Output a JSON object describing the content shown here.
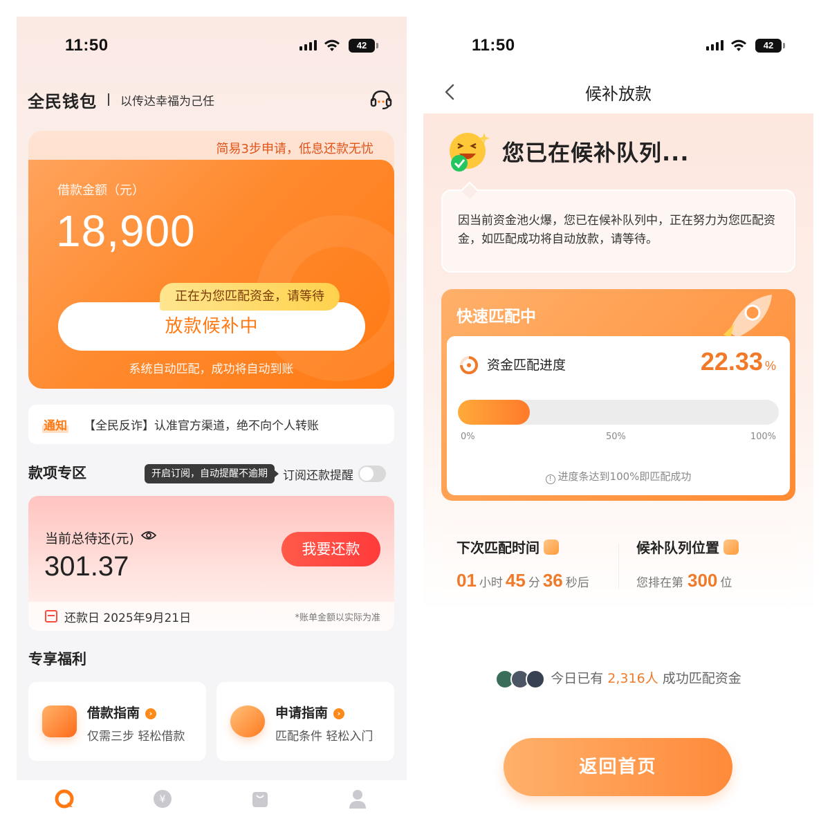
{
  "left": {
    "status": {
      "time": "11:50",
      "battery": "42"
    },
    "header": {
      "brand": "全民钱包",
      "slogan": "以传达幸福为己任"
    },
    "loan_card": {
      "tagline": "简易3步申请，低息还款无忧",
      "amount_label": "借款金额（元）",
      "amount": "18,900",
      "bubble": "正在为您匹配资金，请等待",
      "status_button": "放款候补中",
      "footer": "系统自动匹配，成功将自动到账"
    },
    "notice": {
      "badge": "通知",
      "text": "【全民反诈】认准官方渠道，绝不向个人转账"
    },
    "repay_section": {
      "title": "款项专区",
      "tooltip": "开启订阅，自动提醒不逾期",
      "subscribe_label": "订阅还款提醒",
      "subscribe_on": false
    },
    "repay_card": {
      "label": "当前总待还(元)",
      "amount": "301.37",
      "button": "我要还款",
      "date": "还款日 2025年9月21日",
      "note": "*账单金额以实际为准"
    },
    "benefits": {
      "title": "专享福利",
      "items": [
        {
          "title": "借款指南",
          "subtitle": "仅需三步 轻松借款"
        },
        {
          "title": "申请指南",
          "subtitle": "匹配条件 轻松入门"
        }
      ]
    },
    "tabbar": {
      "icons": [
        "home-icon",
        "yuan-icon",
        "bag-icon",
        "user-icon"
      ],
      "active_color": "#ff7a14"
    }
  },
  "right": {
    "status": {
      "time": "11:50",
      "battery": "42"
    },
    "nav": {
      "title": "候补放款"
    },
    "queue_title": "您已在候补队列...",
    "info_text": "因当前资金池火爆，您已在候补队列中，正在努力为您匹配资金，如匹配成功将自动放款，请等待。",
    "match_panel": {
      "heading": "快速匹配中",
      "progress_label": "资金匹配进度",
      "progress_value": "22.33",
      "progress_unit": "%",
      "progress_fraction": 0.2233,
      "ticks": [
        "0%",
        "50%",
        "100%"
      ],
      "hint": "进度条达到100%即匹配成功"
    },
    "stats": {
      "next_match_title": "下次匹配时间",
      "hours": "01",
      "hours_unit": "小时",
      "minutes": "45",
      "minutes_unit": "分",
      "seconds": "36",
      "seconds_unit": "秒后",
      "queue_title": "候补队列位置",
      "queue_prefix": "您排在第",
      "queue_position": "300",
      "queue_suffix": "位"
    },
    "social": {
      "prefix": "今日已有",
      "count": "2,316人",
      "suffix": "成功匹配资金"
    },
    "home_button": "返回首页"
  },
  "colors": {
    "accent": "#ff7a14",
    "repay_red": "#ff3b3b",
    "progress_orange": "#f07a2a"
  }
}
